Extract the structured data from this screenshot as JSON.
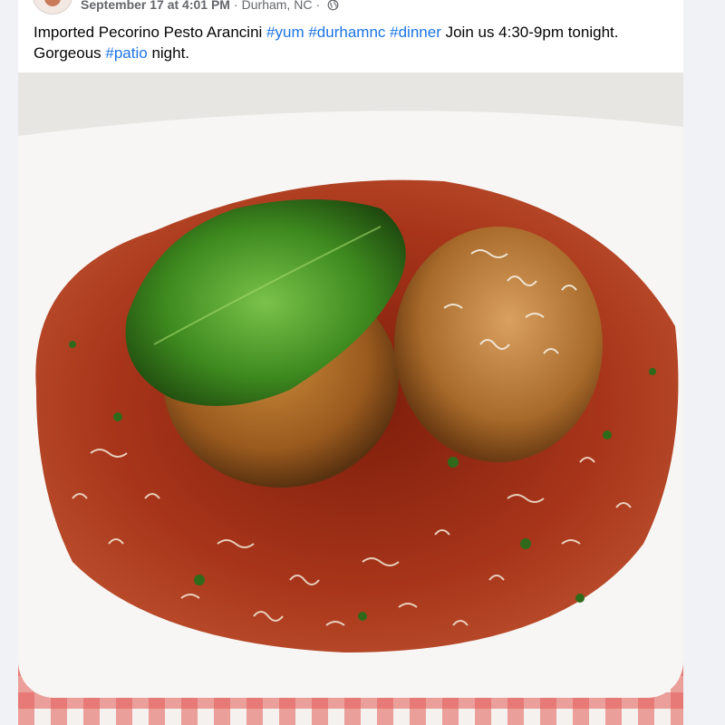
{
  "post": {
    "date": "September 17 at 4:01 PM",
    "location": "Durham, NC",
    "separator": "·",
    "caption_parts": [
      {
        "text": "Imported Pecorino Pesto Arancini ",
        "hashtag": false
      },
      {
        "text": "#yum",
        "hashtag": true
      },
      {
        "text": " ",
        "hashtag": false
      },
      {
        "text": "#durhamnc",
        "hashtag": true
      },
      {
        "text": " ",
        "hashtag": false
      },
      {
        "text": "#dinner",
        "hashtag": true
      },
      {
        "text": " Join us 4:30-9pm tonight. Gorgeous ",
        "hashtag": false
      },
      {
        "text": "#patio",
        "hashtag": true
      },
      {
        "text": " night.",
        "hashtag": false
      }
    ]
  },
  "icons": {
    "privacy": "globe-icon",
    "avatar": "restaurant-avatar"
  },
  "colors": {
    "hashtag": "#1b74e4",
    "meta_text": "#65676b",
    "body_text": "#050505",
    "sauce": "#9c2a14",
    "basil": "#3d8a1e"
  }
}
